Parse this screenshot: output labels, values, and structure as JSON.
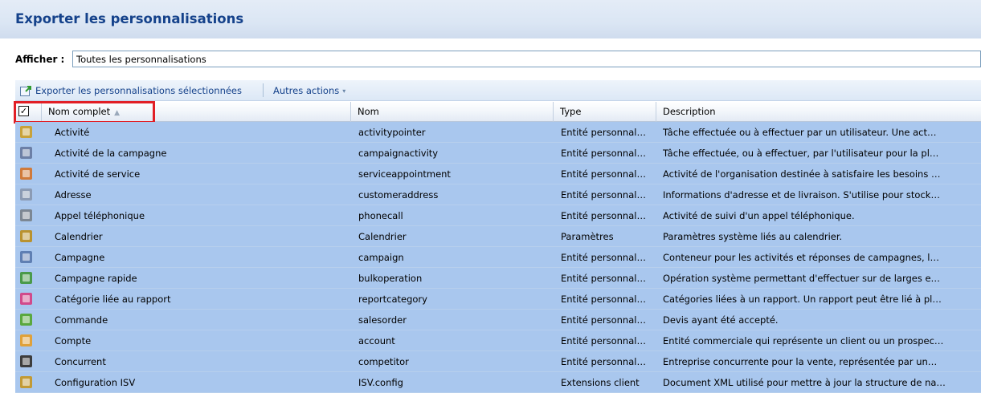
{
  "page": {
    "title": "Exporter les personnalisations"
  },
  "filter": {
    "label": "Afficher :",
    "value": "Toutes les personnalisations"
  },
  "toolbar": {
    "export_label": "Exporter les personnalisations sélectionnées",
    "more_label": "Autres actions",
    "more_caret": "▾"
  },
  "grid": {
    "select_all_checked": true,
    "select_all_mark": "✓",
    "sort_indicator": "▲",
    "columns": {
      "full_name": "Nom complet",
      "name": "Nom",
      "type": "Type",
      "description": "Description"
    },
    "rows": [
      {
        "icon": "activity-icon",
        "icon_color": "#c8a23a",
        "full_name": "Activité",
        "name": "activitypointer",
        "type": "Entité personnal…",
        "description": "Tâche effectuée ou à effectuer par un utilisateur. Une act…"
      },
      {
        "icon": "campaign-activity-icon",
        "icon_color": "#6c7fa6",
        "full_name": "Activité de la campagne",
        "name": "campaignactivity",
        "type": "Entité personnal…",
        "description": "Tâche effectuée, ou à effectuer, par l'utilisateur pour la pl…"
      },
      {
        "icon": "service-activity-icon",
        "icon_color": "#d07a3a",
        "full_name": "Activité de service",
        "name": "serviceappointment",
        "type": "Entité personnal…",
        "description": "Activité de l'organisation destinée à satisfaire les besoins …"
      },
      {
        "icon": "address-icon",
        "icon_color": "#8b9bb4",
        "full_name": "Adresse",
        "name": "customeraddress",
        "type": "Entité personnal…",
        "description": "Informations d'adresse et de livraison. S'utilise pour stock…"
      },
      {
        "icon": "phone-call-icon",
        "icon_color": "#7c8793",
        "full_name": "Appel téléphonique",
        "name": "phonecall",
        "type": "Entité personnal…",
        "description": "Activité de suivi d'un appel téléphonique."
      },
      {
        "icon": "calendar-icon",
        "icon_color": "#b9922f",
        "full_name": "Calendrier",
        "name": "Calendrier",
        "type": "Paramètres",
        "description": "Paramètres système liés au calendrier."
      },
      {
        "icon": "campaign-icon",
        "icon_color": "#5f7fb3",
        "full_name": "Campagne",
        "name": "campaign",
        "type": "Entité personnal…",
        "description": "Conteneur pour les activités et réponses de campagnes, l…"
      },
      {
        "icon": "quick-campaign-icon",
        "icon_color": "#4a9a4a",
        "full_name": "Campagne rapide",
        "name": "bulkoperation",
        "type": "Entité personnal…",
        "description": "Opération système permettant d'effectuer sur de larges e…"
      },
      {
        "icon": "report-category-icon",
        "icon_color": "#d14a8b",
        "full_name": "Catégorie liée au rapport",
        "name": "reportcategory",
        "type": "Entité personnal…",
        "description": "Catégories liées à un rapport. Un rapport peut être lié à pl…"
      },
      {
        "icon": "order-icon",
        "icon_color": "#5aa83f",
        "full_name": "Commande",
        "name": "salesorder",
        "type": "Entité personnal…",
        "description": "Devis ayant été accepté."
      },
      {
        "icon": "account-icon",
        "icon_color": "#e0a13a",
        "full_name": "Compte",
        "name": "account",
        "type": "Entité personnal…",
        "description": "Entité commerciale qui représente un client ou un prospec…"
      },
      {
        "icon": "competitor-icon",
        "icon_color": "#3d3d3d",
        "full_name": "Concurrent",
        "name": "competitor",
        "type": "Entité personnal…",
        "description": "Entreprise concurrente pour la vente, représentée par un…"
      },
      {
        "icon": "isv-config-icon",
        "icon_color": "#c29a35",
        "full_name": "Configuration ISV",
        "name": "ISV.config",
        "type": "Extensions client",
        "description": "Document XML utilisé pour mettre à jour la structure de na…"
      }
    ]
  }
}
